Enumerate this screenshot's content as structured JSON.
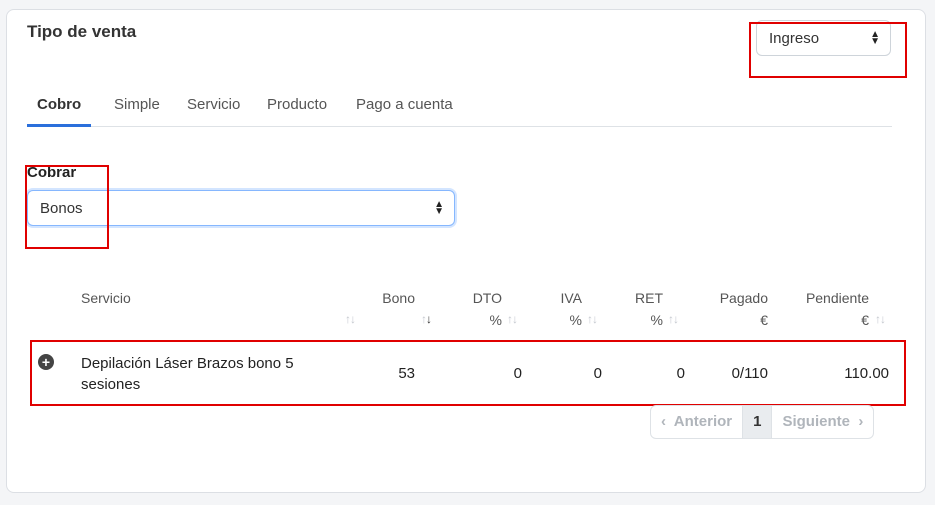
{
  "sale_type": {
    "title": "Tipo de venta",
    "selected": "Ingreso"
  },
  "tabs": [
    {
      "label": "Cobro"
    },
    {
      "label": "Simple"
    },
    {
      "label": "Servicio"
    },
    {
      "label": "Producto"
    },
    {
      "label": "Pago a cuenta"
    }
  ],
  "cobrar": {
    "label": "Cobrar",
    "selected": "Bonos"
  },
  "table": {
    "headers": {
      "servicio": "Servicio",
      "bono": "Bono",
      "dto": "DTO",
      "dto_unit": "%",
      "iva": "IVA",
      "iva_unit": "%",
      "ret": "RET",
      "ret_unit": "%",
      "pagado": "Pagado",
      "pagado_unit": "€",
      "pendiente": "Pendiente",
      "pendiente_unit": "€"
    },
    "rows": [
      {
        "servicio_line1": "Depilación Láser Brazos bono 5",
        "servicio_line2": "sesiones",
        "bono": "53",
        "dto": "0",
        "iva": "0",
        "ret": "0",
        "pagado": "0/110",
        "pendiente": "110.00"
      }
    ]
  },
  "pagination": {
    "prev": "Anterior",
    "current": "1",
    "next": "Siguiente"
  },
  "icons": {
    "expand": "plus-circle-icon",
    "sort": "sort-arrows-icon",
    "select": "chevron-updown-icon"
  },
  "colors": {
    "highlight": "#e00000",
    "tab_active": "#2a6fdb"
  }
}
